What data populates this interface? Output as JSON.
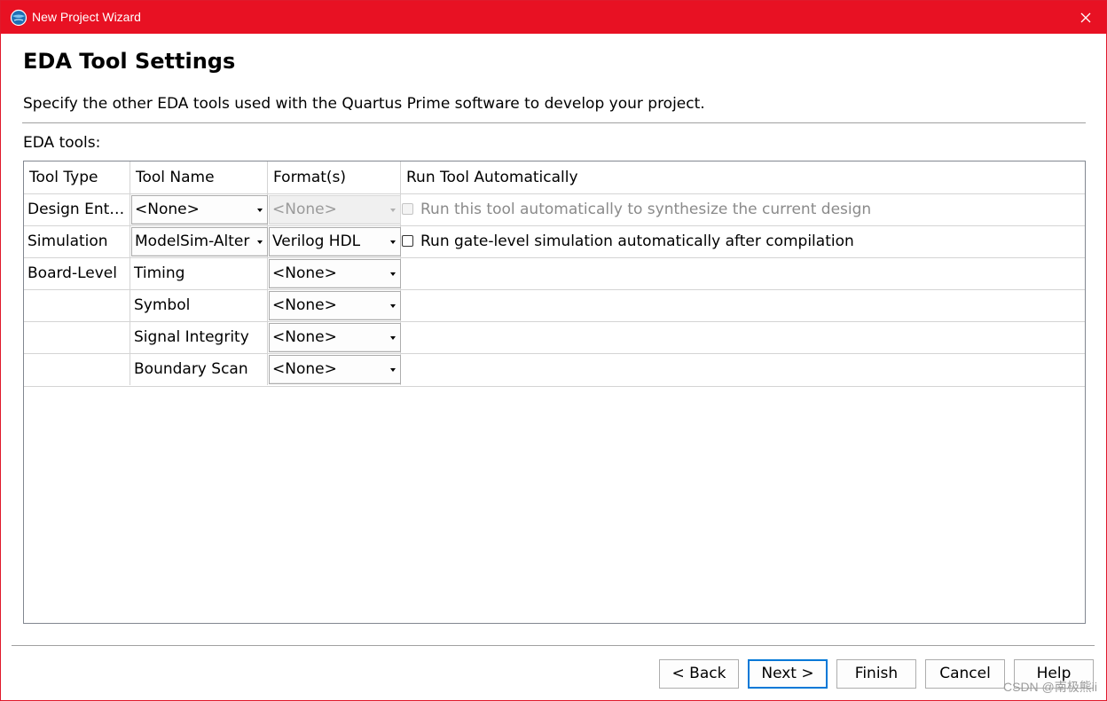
{
  "window": {
    "title": "New Project Wizard"
  },
  "page": {
    "heading": "EDA Tool Settings",
    "description": "Specify the other EDA tools used with the Quartus Prime software to develop your project.",
    "tools_label": "EDA tools:"
  },
  "table": {
    "headers": [
      "Tool Type",
      "Tool Name",
      "Format(s)",
      "Run Tool Automatically"
    ],
    "rows": [
      {
        "type": "Design Ent…",
        "name": "<None>",
        "format": "<None>",
        "run_label": "Run this tool automatically to synthesize the current design",
        "run_checked": false,
        "format_enabled": false
      },
      {
        "type": "Simulation",
        "name": "ModelSim-Alter",
        "format": "Verilog HDL",
        "run_label": "Run gate-level simulation automatically after compilation",
        "run_checked": false,
        "format_enabled": true
      },
      {
        "type": "Board-Level",
        "name": "Timing",
        "format": "<None>"
      },
      {
        "type": "",
        "name": "Symbol",
        "format": "<None>"
      },
      {
        "type": "",
        "name": "Signal Integrity",
        "format": "<None>"
      },
      {
        "type": "",
        "name": "Boundary Scan",
        "format": "<None>"
      }
    ]
  },
  "buttons": {
    "back": "< Back",
    "next": "Next >",
    "finish": "Finish",
    "cancel": "Cancel",
    "help": "Help"
  },
  "watermark": "CSDN @南极熊ii",
  "colors": {
    "titlebar": "#e81123",
    "accent": "#0078d7"
  },
  "icons": {
    "app": "quartus-globe-icon",
    "close": "close-icon",
    "dropdown": "dropdown-arrow-icon"
  }
}
